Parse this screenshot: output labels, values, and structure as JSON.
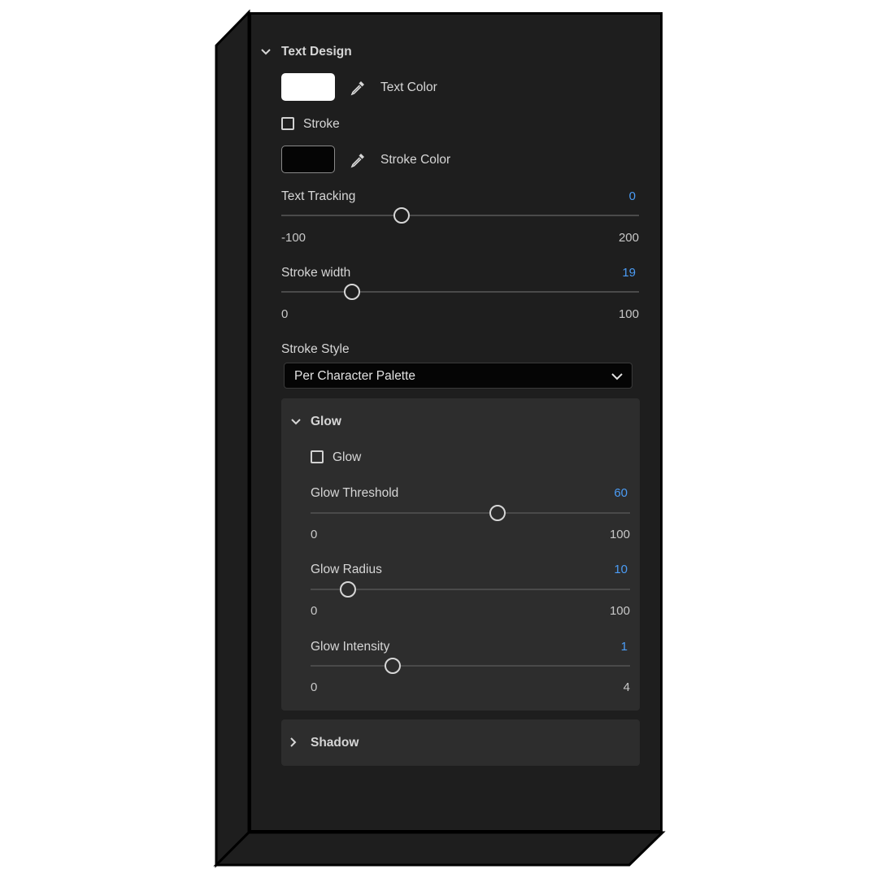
{
  "text_design": {
    "header": "Text Design",
    "text_color_label": "Text Color",
    "text_color": "#ffffff",
    "stroke_label": "Stroke",
    "stroke_checked": false,
    "stroke_color_label": "Stroke Color",
    "stroke_color": "#050505",
    "text_tracking": {
      "label": "Text Tracking",
      "value": "0",
      "min": "-100",
      "max": "200"
    },
    "stroke_width": {
      "label": "Stroke width",
      "value": "19",
      "min": "0",
      "max": "100"
    },
    "stroke_style": {
      "label": "Stroke Style",
      "selected": "Per Character Palette"
    }
  },
  "glow": {
    "header": "Glow",
    "checkbox_label": "Glow",
    "checked": false,
    "threshold": {
      "label": "Glow Threshold",
      "value": "60",
      "min": "0",
      "max": "100"
    },
    "radius": {
      "label": "Glow Radius",
      "value": "10",
      "min": "0",
      "max": "100"
    },
    "intensity": {
      "label": "Glow Intensity",
      "value": "1",
      "min": "0",
      "max": "4"
    }
  },
  "shadow": {
    "header": "Shadow",
    "expanded": false
  },
  "colors": {
    "accent": "#4b9cf5",
    "panel": "#1e1e1e",
    "section": "#2d2d2d"
  }
}
